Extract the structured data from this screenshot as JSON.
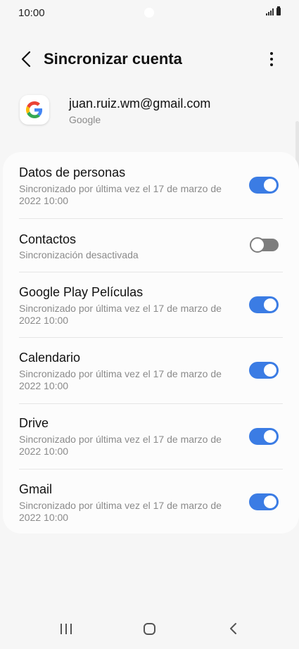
{
  "status_bar": {
    "time": "10:00"
  },
  "header": {
    "title": "Sincronizar cuenta"
  },
  "account": {
    "email": "juan.ruiz.wm@gmail.com",
    "type": "Google"
  },
  "sync_items": [
    {
      "title": "Datos de personas",
      "subtitle": "Sincronizado por última vez el 17 de marzo de 2022 10:00",
      "enabled": true
    },
    {
      "title": "Contactos",
      "subtitle": "Sincronización desactivada",
      "enabled": false
    },
    {
      "title": "Google Play Películas",
      "subtitle": "Sincronizado por última vez el 17 de marzo de 2022 10:00",
      "enabled": true
    },
    {
      "title": "Calendario",
      "subtitle": "Sincronizado por última vez el 17 de marzo de 2022 10:00",
      "enabled": true
    },
    {
      "title": "Drive",
      "subtitle": "Sincronizado por última vez el 17 de marzo de 2022 10:00",
      "enabled": true
    },
    {
      "title": "Gmail",
      "subtitle": "Sincronizado por última vez el 17 de marzo de 2022 10:00",
      "enabled": true
    }
  ],
  "colors": {
    "accent": "#3b7ce4",
    "toggle_off": "#7d7d7d",
    "background": "#f6f6f6",
    "card": "#fcfcfc"
  },
  "icons": [
    "back-arrow-icon",
    "more-options-icon",
    "google-icon",
    "signal-icon",
    "battery-icon",
    "recent-apps-icon",
    "home-icon",
    "back-nav-icon"
  ]
}
